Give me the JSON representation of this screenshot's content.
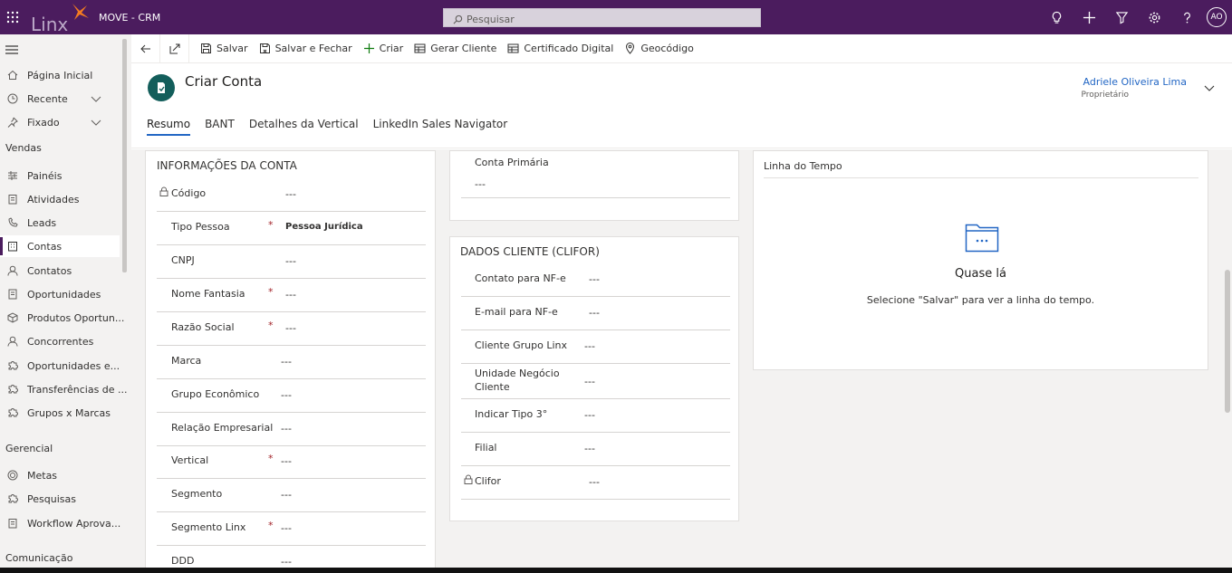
{
  "topbar": {
    "app_name": "MOVE - CRM",
    "logo_text": "Linx",
    "search_placeholder": "Pesquisar",
    "user_initials": "AO"
  },
  "sidebar": {
    "items": [
      {
        "label": "Página Inicial",
        "icon": "home-icon"
      },
      {
        "label": "Recente",
        "icon": "clock-icon",
        "expandable": true
      },
      {
        "label": "Fixado",
        "icon": "pin-icon",
        "expandable": true
      }
    ],
    "groups": [
      {
        "title": "Vendas",
        "items": [
          {
            "label": "Painéis",
            "icon": "dashboard-icon"
          },
          {
            "label": "Atividades",
            "icon": "clipboard-icon"
          },
          {
            "label": "Leads",
            "icon": "phone-person-icon"
          },
          {
            "label": "Contas",
            "icon": "building-icon",
            "active": true
          },
          {
            "label": "Contatos",
            "icon": "person-icon"
          },
          {
            "label": "Oportunidades",
            "icon": "document-icon"
          },
          {
            "label": "Produtos Oportun...",
            "icon": "box-icon"
          },
          {
            "label": "Concorrentes",
            "icon": "person-icon"
          },
          {
            "label": "Oportunidades e...",
            "icon": "puzzle-icon"
          },
          {
            "label": "Transferências de ...",
            "icon": "puzzle-icon"
          },
          {
            "label": "Grupos x Marcas",
            "icon": "puzzle-icon"
          }
        ]
      },
      {
        "title": "Gerencial",
        "items": [
          {
            "label": "Metas",
            "icon": "target-icon"
          },
          {
            "label": "Pesquisas",
            "icon": "puzzle-icon"
          },
          {
            "label": "Workflow Aprova...",
            "icon": "clipboard-icon"
          }
        ]
      },
      {
        "title": "Comunicação",
        "items": []
      }
    ]
  },
  "commandbar": {
    "save": "Salvar",
    "save_close": "Salvar e Fechar",
    "create": "Criar",
    "gen_client": "Gerar Cliente",
    "cert": "Certificado Digital",
    "geo": "Geocódigo"
  },
  "header": {
    "title": "Criar Conta",
    "owner_name": "Adriele Oliveira Lima",
    "owner_label": "Proprietário",
    "tabs": [
      "Resumo",
      "BANT",
      "Detalhes da Vertical",
      "LinkedIn Sales Navigator"
    ]
  },
  "account_info": {
    "title": "INFORMAÇÕES DA CONTA",
    "fields": [
      {
        "label": "Código",
        "value": "---",
        "locked": true,
        "required": false
      },
      {
        "label": "Tipo Pessoa",
        "value": "Pessoa Jurídica",
        "required": true,
        "bold": true
      },
      {
        "label": "CNPJ",
        "value": "---",
        "required": false
      },
      {
        "label": "Nome Fantasia",
        "value": "---",
        "required": true
      },
      {
        "label": "Razão Social",
        "value": "---",
        "required": true
      },
      {
        "label": "Marca",
        "value": "---",
        "required": false
      },
      {
        "label": "Grupo Econômico",
        "value": "---",
        "required": false
      },
      {
        "label": "Relação Empresarial",
        "value": "---",
        "required": false
      },
      {
        "label": "Vertical",
        "value": "---",
        "required": true
      },
      {
        "label": "Segmento",
        "value": "---",
        "required": false
      },
      {
        "label": "Segmento Linx",
        "value": "---",
        "required": true
      },
      {
        "label": "DDD",
        "value": "---",
        "required": false
      }
    ]
  },
  "primary_account": {
    "label": "Conta Primária",
    "value": "---"
  },
  "client_data": {
    "title": "DADOS CLIENTE (CLIFOR)",
    "fields": [
      {
        "label": "Contato para NF-e",
        "value": "---"
      },
      {
        "label": "E-mail para NF-e",
        "value": "---"
      },
      {
        "label": "Cliente Grupo Linx",
        "value": "---"
      },
      {
        "label": "Unidade Negócio Cliente",
        "value": "---"
      },
      {
        "label": "Indicar Tipo 3°",
        "value": "---"
      },
      {
        "label": "Filial",
        "value": "---"
      },
      {
        "label": "Clifor",
        "value": "---",
        "locked": true
      }
    ]
  },
  "timeline": {
    "title": "Linha do Tempo",
    "heading": "Quase lá",
    "message": "Selecione \"Salvar\" para ver a linha do tempo."
  }
}
